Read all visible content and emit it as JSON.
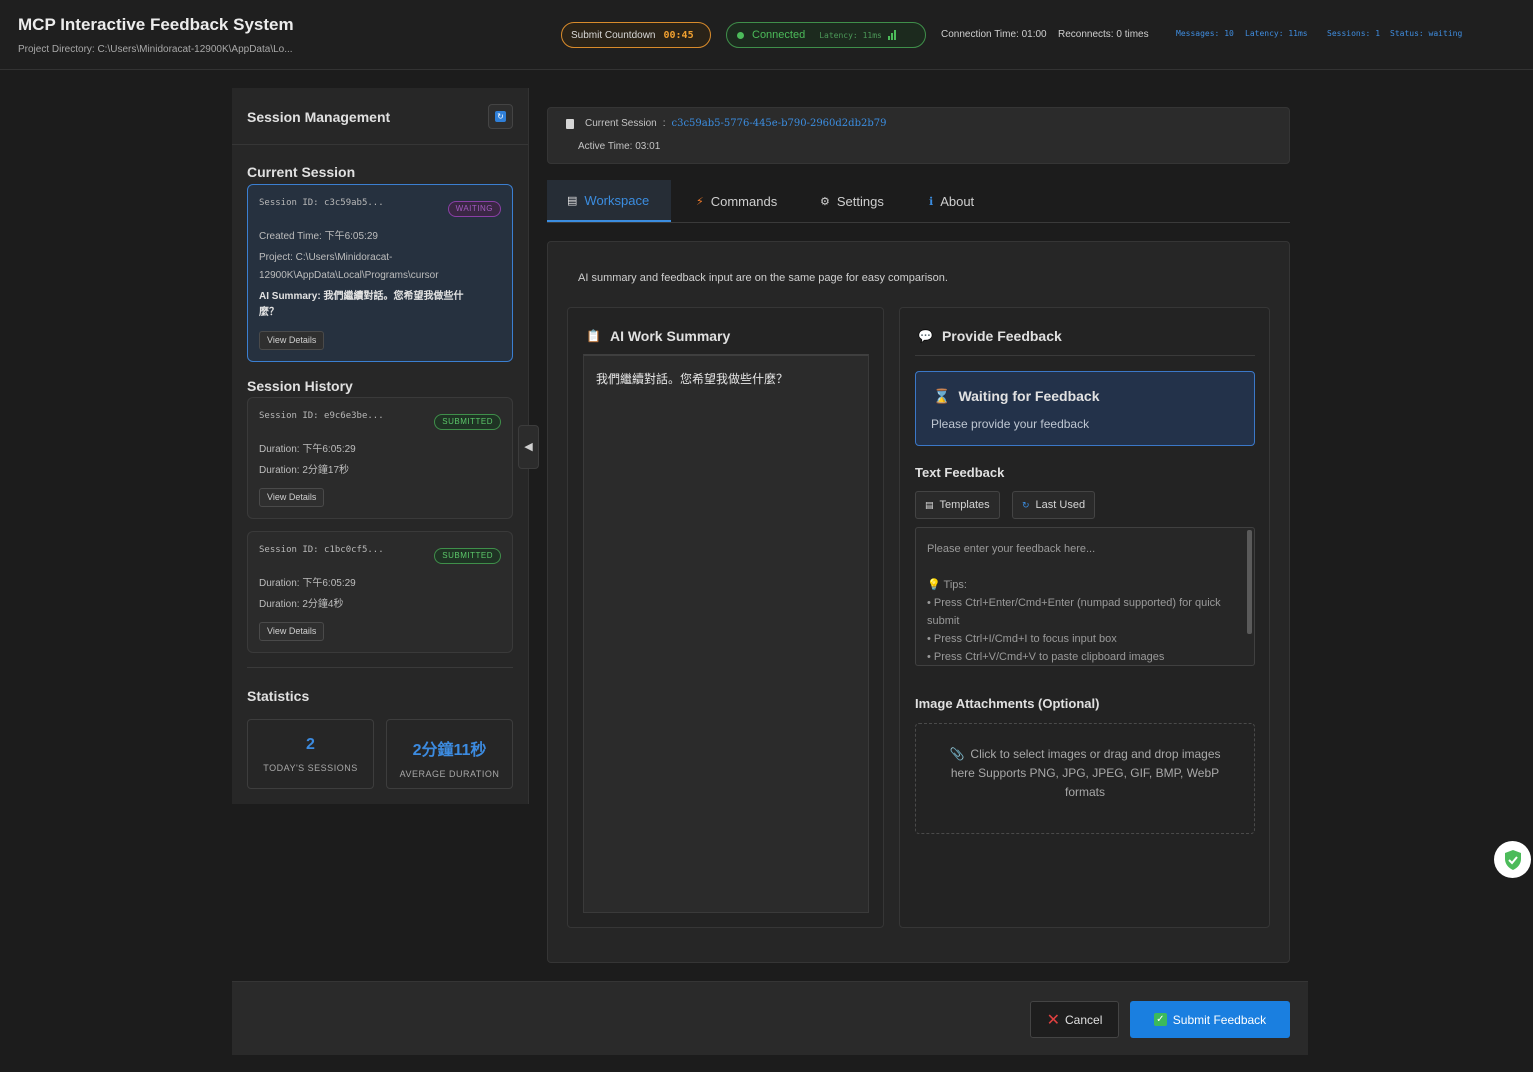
{
  "header": {
    "title": "MCP Interactive Feedback System",
    "project_dir": "Project Directory: C:\\Users\\Minidoracat-12900K\\AppData\\Lo...",
    "countdown_label": "Submit Countdown",
    "countdown_value": "00:45",
    "connection_status": "Connected",
    "connection_latency": "Latency: 11ms",
    "connection_time": "Connection Time: 01:00",
    "reconnects": "Reconnects: 0 times",
    "stats": {
      "messages_label": "Messages:",
      "messages_value": "10",
      "latency_label": "Latency:",
      "latency_value": "11ms",
      "sessions_label": "Sessions:",
      "sessions_value": "1",
      "status_label": "Status:",
      "status_value": "waiting"
    }
  },
  "sidebar": {
    "title": "Session Management",
    "current_label": "Current Session",
    "current": {
      "session_id": "Session ID: c3c59ab5...",
      "badge": "WAITING",
      "created": "Created Time: 下午6:05:29",
      "project_line1": "Project: C:\\Users\\Minidoracat-",
      "project_line2": "12900K\\AppData\\Local\\Programs\\cursor",
      "summary_line1": "AI Summary: 我們繼續對話。您希望我做些什",
      "summary_line2": "麼？",
      "details": "View Details"
    },
    "history_label": "Session History",
    "history": [
      {
        "session_id": "Session ID: e9c6e3be...",
        "badge": "SUBMITTED",
        "line1": "Duration: 下午6:05:29",
        "line2": "Duration: 2分鐘17秒",
        "details": "View Details"
      },
      {
        "session_id": "Session ID: c1bc0cf5...",
        "badge": "SUBMITTED",
        "line1": "Duration: 下午6:05:29",
        "line2": "Duration: 2分鐘4秒",
        "details": "View Details"
      }
    ],
    "statistics_label": "Statistics",
    "stats": [
      {
        "value": "2",
        "label": "TODAY'S SESSIONS"
      },
      {
        "value": "2分鐘11秒",
        "label": "AVERAGE DURATION"
      }
    ]
  },
  "session_bar": {
    "label": "Current Session",
    "separator": ":",
    "id": "c3c59ab5-5776-445e-b790-2960d2db2b79",
    "active_time": "Active Time: 03:01"
  },
  "tabs": [
    {
      "label": "Workspace",
      "icon": "document-icon"
    },
    {
      "label": "Commands",
      "icon": "lightning-icon"
    },
    {
      "label": "Settings",
      "icon": "gear-icon"
    },
    {
      "label": "About",
      "icon": "info-icon"
    }
  ],
  "workspace": {
    "description": "AI summary and feedback input are on the same page for easy comparison.",
    "summary_title": "AI Work Summary",
    "summary_text": "我們繼續對話。您希望我做些什麼？",
    "feedback_title": "Provide Feedback",
    "waiting_title": "Waiting for Feedback",
    "waiting_sub": "Please provide your feedback",
    "text_feedback_label": "Text Feedback",
    "templates_btn": "Templates",
    "last_used_btn": "Last Used",
    "placeholder": "Please enter your feedback here...\n\n💡 Tips:\n• Press Ctrl+Enter/Cmd+Enter (numpad supported) for quick submit\n• Press Ctrl+I/Cmd+I to focus input box\n• Press Ctrl+V/Cmd+V to paste clipboard images",
    "attachments_label": "Image Attachments (Optional)",
    "dropzone_text": "Click to select images or drag and drop images here Supports PNG, JPG, JPEG, GIF, BMP, WebP formats"
  },
  "footer": {
    "cancel": "Cancel",
    "submit": "Submit Feedback"
  },
  "colors": {
    "accent": "#1a7fe0",
    "waiting": "#a35bc0",
    "submitted": "#5cc86a",
    "countdown": "#f0a030"
  }
}
